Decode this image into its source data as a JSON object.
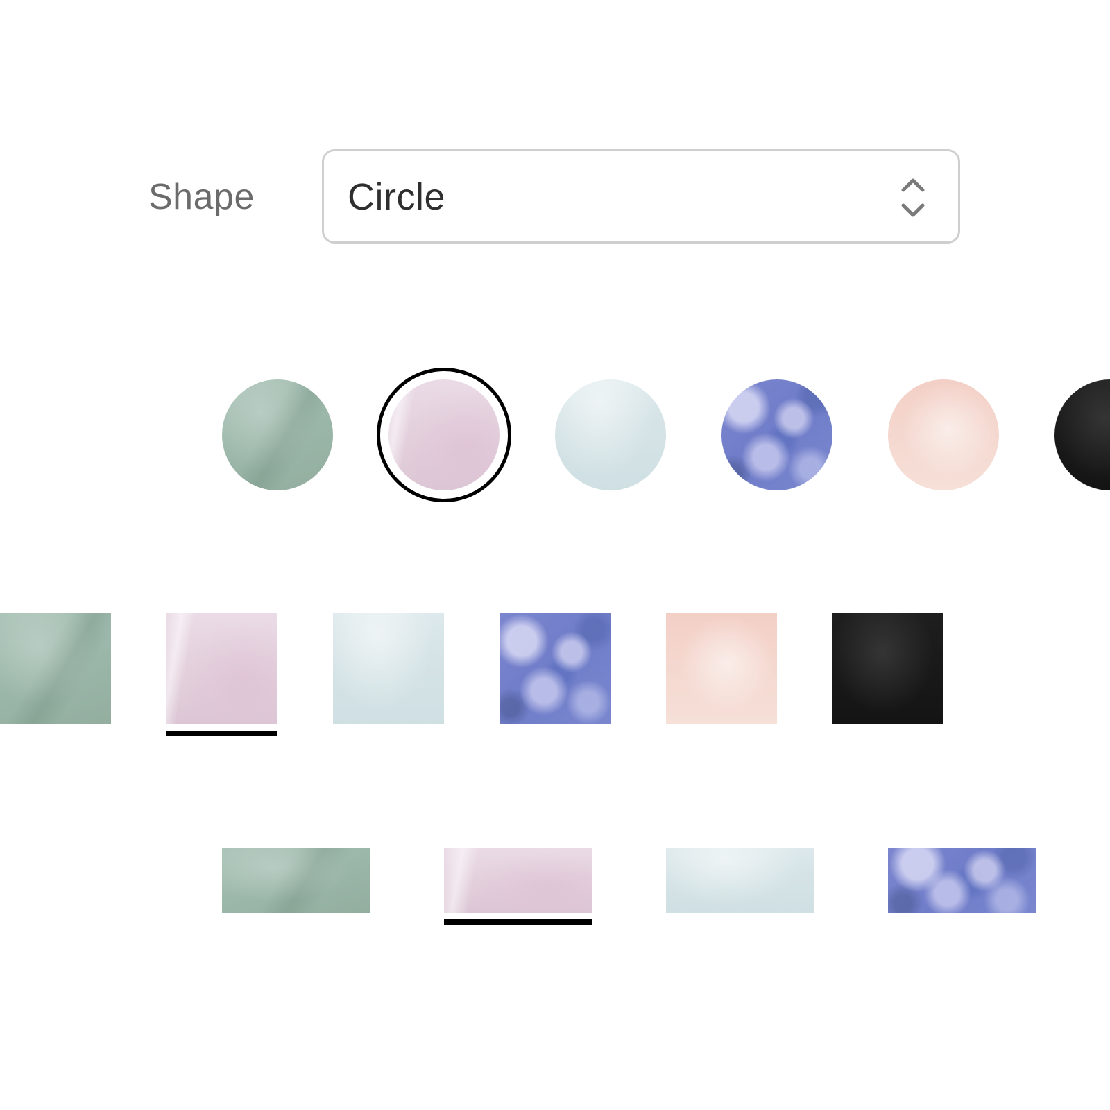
{
  "shape_field": {
    "label": "Shape",
    "selected": "Circle",
    "chevron_icon": "up-down-chevron-icon"
  },
  "materials": [
    "jade",
    "rose",
    "ice",
    "sodalite",
    "peach",
    "onyx"
  ],
  "colors": {
    "jade": "#a2bdb0",
    "rose": "#e6d5e0",
    "ice": "#d8e6e9",
    "sodalite": "#7480cb",
    "peach": "#f4d6cd",
    "onyx": "#171717",
    "selection": "#000000",
    "select_border": "#cfcfcf"
  },
  "rows": {
    "circle": {
      "selected_index": 1
    },
    "square": {
      "selected_index": 1
    },
    "rectangle": {
      "selected_index": 1
    }
  }
}
